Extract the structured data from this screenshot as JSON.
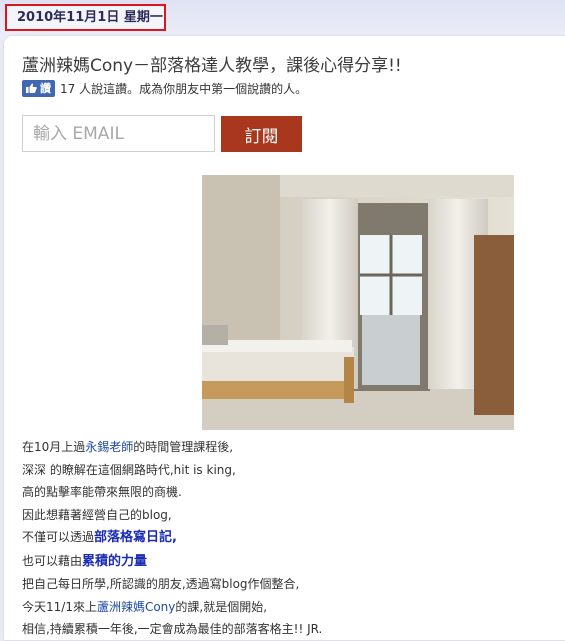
{
  "post": {
    "date": "2010年11月1日 星期一",
    "title": "蘆洲辣媽Cony－部落格達人教學，課後心得分享!!"
  },
  "like": {
    "button_label": "讚",
    "text": "17 人說這讚。成為你朋友中第一個說讚的人。"
  },
  "subscribe": {
    "email_placeholder": "輸入 EMAIL",
    "button_label": "訂閱"
  },
  "body": {
    "l1_a": "在10月上過",
    "l1_link": "永錫老師",
    "l1_b": "的時間管理課程後,",
    "l2": "深深 的瞭解在這個網路時代,hit is king,",
    "l3": "高的點擊率能帶來無限的商機.",
    "l4": "因此想藉著經營自己的blog,",
    "l5_a": "不僅可以透過",
    "l5_b": "部落格寫日記,",
    "l6_a": "也可以藉由",
    "l6_b": "累積的力量",
    "l7": "把自己每日所學,所認識的朋友,透過寫blog作個整合,",
    "l8_a": "今天11/1來上",
    "l8_link": "蘆洲辣媽Cony",
    "l8_b": "的課,就是個開始,",
    "l9": "相信,持續累積一年後,一定會成為最佳的部落客格主!!  JR."
  }
}
